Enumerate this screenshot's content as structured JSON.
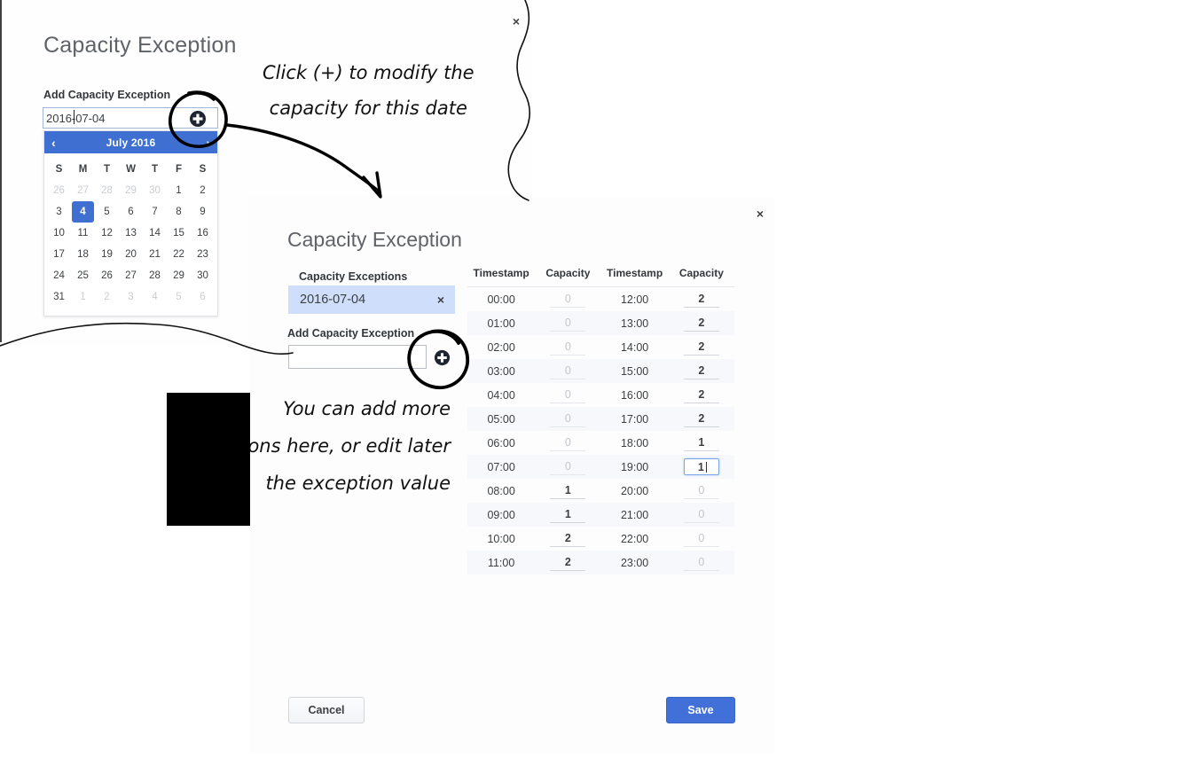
{
  "panel1": {
    "title": "Capacity Exception",
    "close_label": "×",
    "add_label": "Add Capacity Exception",
    "date_value": "2016-07-04",
    "add_button_icon": "plus-circle-icon",
    "datepicker": {
      "month_label": "July 2016",
      "prev_icon": "‹",
      "next_icon": "›",
      "dow": [
        "S",
        "M",
        "T",
        "W",
        "T",
        "F",
        "S"
      ],
      "weeks": [
        [
          {
            "d": "26",
            "m": true
          },
          {
            "d": "27",
            "m": true
          },
          {
            "d": "28",
            "m": true
          },
          {
            "d": "29",
            "m": true
          },
          {
            "d": "30",
            "m": true
          },
          {
            "d": "1",
            "m": false
          },
          {
            "d": "2",
            "m": false
          }
        ],
        [
          {
            "d": "3",
            "m": false
          },
          {
            "d": "4",
            "m": false,
            "sel": true
          },
          {
            "d": "5",
            "m": false
          },
          {
            "d": "6",
            "m": false
          },
          {
            "d": "7",
            "m": false
          },
          {
            "d": "8",
            "m": false
          },
          {
            "d": "9",
            "m": false
          }
        ],
        [
          {
            "d": "10",
            "m": false
          },
          {
            "d": "11",
            "m": false
          },
          {
            "d": "12",
            "m": false
          },
          {
            "d": "13",
            "m": false
          },
          {
            "d": "14",
            "m": false
          },
          {
            "d": "15",
            "m": false
          },
          {
            "d": "16",
            "m": false
          }
        ],
        [
          {
            "d": "17",
            "m": false
          },
          {
            "d": "18",
            "m": false
          },
          {
            "d": "19",
            "m": false
          },
          {
            "d": "20",
            "m": false
          },
          {
            "d": "21",
            "m": false
          },
          {
            "d": "22",
            "m": false
          },
          {
            "d": "23",
            "m": false
          }
        ],
        [
          {
            "d": "24",
            "m": false
          },
          {
            "d": "25",
            "m": false
          },
          {
            "d": "26",
            "m": false
          },
          {
            "d": "27",
            "m": false
          },
          {
            "d": "28",
            "m": false
          },
          {
            "d": "29",
            "m": false
          },
          {
            "d": "30",
            "m": false
          }
        ],
        [
          {
            "d": "31",
            "m": false
          },
          {
            "d": "1",
            "m": true
          },
          {
            "d": "2",
            "m": true
          },
          {
            "d": "3",
            "m": true
          },
          {
            "d": "4",
            "m": true
          },
          {
            "d": "5",
            "m": true
          },
          {
            "d": "6",
            "m": true
          }
        ]
      ]
    }
  },
  "panel2": {
    "title": "Capacity Exception",
    "close_label": "×",
    "exceptions_label": "Capacity Exceptions",
    "chip_value": "2016-07-04",
    "chip_remove_icon": "×",
    "add_label": "Add Capacity Exception",
    "add_input_value": "",
    "add_button_icon": "plus-circle-icon",
    "cancel_label": "Cancel",
    "save_label": "Save",
    "table": {
      "headers": [
        "Timestamp",
        "Capacity",
        "Timestamp",
        "Capacity"
      ],
      "rows": [
        {
          "ts1": "00:00",
          "cap1": "0",
          "z1": true,
          "ts2": "12:00",
          "cap2": "2",
          "z2": false
        },
        {
          "ts1": "01:00",
          "cap1": "0",
          "z1": true,
          "ts2": "13:00",
          "cap2": "2",
          "z2": false
        },
        {
          "ts1": "02:00",
          "cap1": "0",
          "z1": true,
          "ts2": "14:00",
          "cap2": "2",
          "z2": false
        },
        {
          "ts1": "03:00",
          "cap1": "0",
          "z1": true,
          "ts2": "15:00",
          "cap2": "2",
          "z2": false
        },
        {
          "ts1": "04:00",
          "cap1": "0",
          "z1": true,
          "ts2": "16:00",
          "cap2": "2",
          "z2": false
        },
        {
          "ts1": "05:00",
          "cap1": "0",
          "z1": true,
          "ts2": "17:00",
          "cap2": "2",
          "z2": false
        },
        {
          "ts1": "06:00",
          "cap1": "0",
          "z1": true,
          "ts2": "18:00",
          "cap2": "1",
          "z2": false
        },
        {
          "ts1": "07:00",
          "cap1": "0",
          "z1": true,
          "ts2": "19:00",
          "cap2": "1",
          "z2": false,
          "focus2": true
        },
        {
          "ts1": "08:00",
          "cap1": "1",
          "z1": false,
          "ts2": "20:00",
          "cap2": "0",
          "z2": true
        },
        {
          "ts1": "09:00",
          "cap1": "1",
          "z1": false,
          "ts2": "21:00",
          "cap2": "0",
          "z2": true
        },
        {
          "ts1": "10:00",
          "cap1": "2",
          "z1": false,
          "ts2": "22:00",
          "cap2": "0",
          "z2": true
        },
        {
          "ts1": "11:00",
          "cap1": "2",
          "z1": false,
          "ts2": "23:00",
          "cap2": "0",
          "z2": true
        }
      ]
    }
  },
  "annotations": {
    "note1_line1": "Click (+) to modify the",
    "note1_line2": "capacity for this date",
    "note2_line1": "You can add more",
    "note2_line2": "exceptions here, or edit later",
    "note2_line3": "the  exception value"
  },
  "colors": {
    "accent_blue": "#3f6fd1",
    "save_blue": "#4170d8",
    "chip_blue": "#cfdefa",
    "muted_text": "#c3c7cd",
    "title_grey": "#5f6368"
  }
}
